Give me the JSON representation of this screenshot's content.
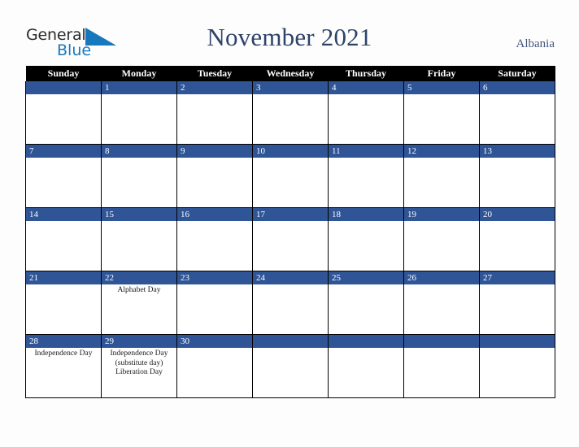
{
  "brand": {
    "name_part1": "General",
    "name_part2": "Blue",
    "triangle_color": "#1878be"
  },
  "header": {
    "title": "November 2021",
    "country": "Albania"
  },
  "colors": {
    "date_bar": "#2f5597",
    "header_row": "#000000",
    "title_text": "#2e4369",
    "page_background": "#fdfdfd"
  },
  "calendar": {
    "month": "November",
    "year": "2021",
    "weekday_headers": [
      "Sunday",
      "Monday",
      "Tuesday",
      "Wednesday",
      "Thursday",
      "Friday",
      "Saturday"
    ],
    "weeks": [
      [
        {
          "date": "",
          "events": []
        },
        {
          "date": "1",
          "events": []
        },
        {
          "date": "2",
          "events": []
        },
        {
          "date": "3",
          "events": []
        },
        {
          "date": "4",
          "events": []
        },
        {
          "date": "5",
          "events": []
        },
        {
          "date": "6",
          "events": []
        }
      ],
      [
        {
          "date": "7",
          "events": []
        },
        {
          "date": "8",
          "events": []
        },
        {
          "date": "9",
          "events": []
        },
        {
          "date": "10",
          "events": []
        },
        {
          "date": "11",
          "events": []
        },
        {
          "date": "12",
          "events": []
        },
        {
          "date": "13",
          "events": []
        }
      ],
      [
        {
          "date": "14",
          "events": []
        },
        {
          "date": "15",
          "events": []
        },
        {
          "date": "16",
          "events": []
        },
        {
          "date": "17",
          "events": []
        },
        {
          "date": "18",
          "events": []
        },
        {
          "date": "19",
          "events": []
        },
        {
          "date": "20",
          "events": []
        }
      ],
      [
        {
          "date": "21",
          "events": []
        },
        {
          "date": "22",
          "events": [
            "Alphabet Day"
          ]
        },
        {
          "date": "23",
          "events": []
        },
        {
          "date": "24",
          "events": []
        },
        {
          "date": "25",
          "events": []
        },
        {
          "date": "26",
          "events": []
        },
        {
          "date": "27",
          "events": []
        }
      ],
      [
        {
          "date": "28",
          "events": [
            "Independence Day"
          ]
        },
        {
          "date": "29",
          "events": [
            "Independence Day (substitute day)",
            "Liberation Day"
          ]
        },
        {
          "date": "30",
          "events": []
        },
        {
          "date": "",
          "events": []
        },
        {
          "date": "",
          "events": []
        },
        {
          "date": "",
          "events": []
        },
        {
          "date": "",
          "events": []
        }
      ]
    ]
  }
}
